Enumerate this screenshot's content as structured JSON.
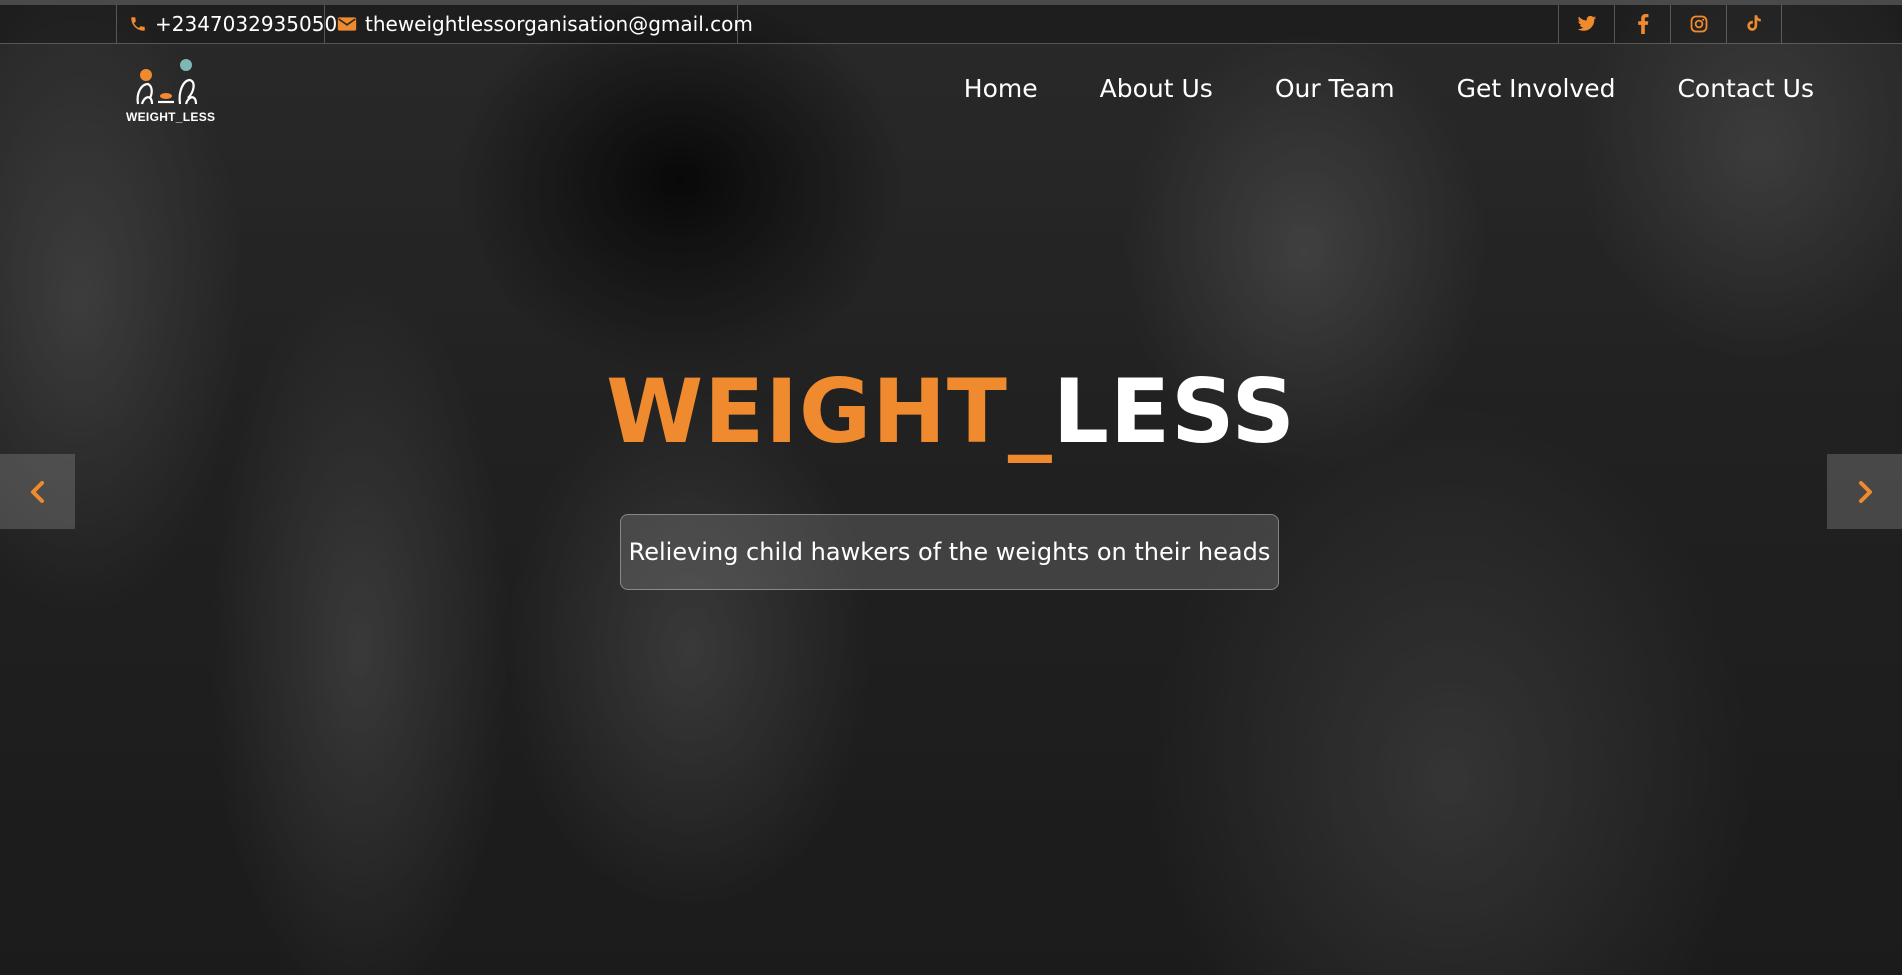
{
  "topbar": {
    "phone": "+2347032935050",
    "email": "theweightlessorganisation@gmail.com",
    "socials": [
      {
        "name": "twitter-icon"
      },
      {
        "name": "facebook-icon"
      },
      {
        "name": "instagram-icon"
      },
      {
        "name": "tiktok-icon"
      }
    ]
  },
  "logo": {
    "text": "WEIGHT_LESS"
  },
  "nav": {
    "items": [
      {
        "label": "Home"
      },
      {
        "label": "About Us"
      },
      {
        "label": "Our Team"
      },
      {
        "label": "Get Involved"
      },
      {
        "label": "Contact Us"
      }
    ]
  },
  "hero": {
    "title_accent": "WEIGHT_",
    "title_plain": "LESS",
    "tagline": "Relieving child hawkers of the weights on their heads"
  },
  "colors": {
    "accent": "#f08a2e",
    "text": "#ffffff"
  }
}
